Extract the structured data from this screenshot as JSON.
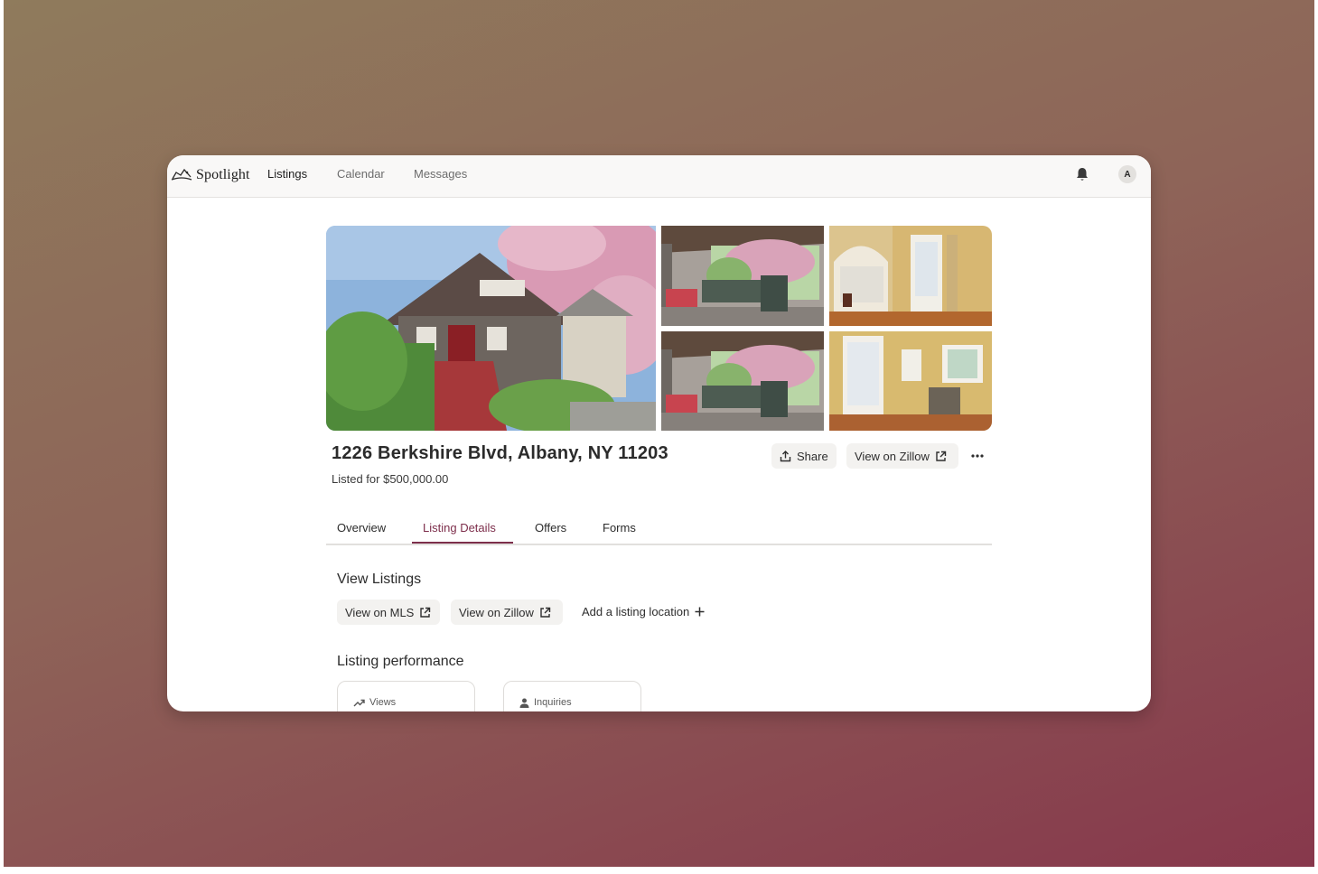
{
  "app": {
    "brand": "Spotlight",
    "nav": [
      {
        "label": "Listings",
        "active": true
      },
      {
        "label": "Calendar",
        "active": false
      },
      {
        "label": "Messages",
        "active": false
      }
    ],
    "avatar_initial": "A",
    "notification_icon": "bell-icon"
  },
  "listing": {
    "address": "1226 Berkshire Blvd, Albany, NY 11203",
    "price_text": "Listed for $500,000.00",
    "actions": {
      "share_label": "Share",
      "zillow_label": "View on Zillow",
      "more_icon": "more-horizontal-icon"
    },
    "photos": [
      "house-exterior",
      "front-porch",
      "living-room",
      "front-porch-alt",
      "bedroom"
    ]
  },
  "tabs": [
    {
      "label": "Overview",
      "active": false
    },
    {
      "label": "Listing Details",
      "active": true
    },
    {
      "label": "Offers",
      "active": false
    },
    {
      "label": "Forms",
      "active": false
    }
  ],
  "view_listings": {
    "title": "View Listings",
    "mls_label": "View on MLS",
    "zillow_label": "View on Zillow",
    "add_location_label": "Add a listing location"
  },
  "performance": {
    "title": "Listing performance",
    "cards": [
      {
        "label": "Views",
        "icon": "trending-up-icon"
      },
      {
        "label": "Inquiries",
        "icon": "person-icon"
      }
    ]
  },
  "colors": {
    "accent": "#7d2e4b",
    "button_bg": "#f3f2f0",
    "topbar_bg": "#f9f8f7"
  }
}
